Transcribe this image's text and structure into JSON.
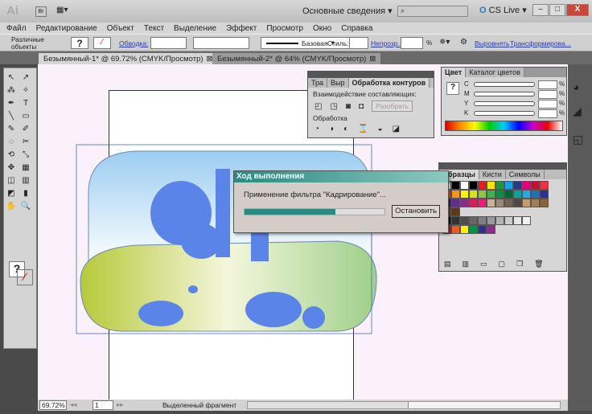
{
  "app": {
    "logo": "Ai",
    "bridge": "Br",
    "workspace": "Основные сведения",
    "search_placeholder": "",
    "cslive": "CS Live"
  },
  "menu": [
    "Файл",
    "Редактирование",
    "Объект",
    "Текст",
    "Выделение",
    "Эффект",
    "Просмотр",
    "Окно",
    "Справка"
  ],
  "control": {
    "selection": "Различные объекты",
    "fill": "?",
    "stroke_label": "Обводка:",
    "brush": "Базовая",
    "style_label": "Стиль:",
    "opacity_label": "Непрозр.:",
    "opacity_unit": "%",
    "align": "Выровнять",
    "transform": "Трансформирова..."
  },
  "tabs": [
    {
      "label": "Безымянный-1* @ 69.72% (CMYK/Просмотр)",
      "active": true
    },
    {
      "label": "Безымянный-2* @ 64% (CMYK/Просмотр)",
      "active": false
    }
  ],
  "pathfinder": {
    "tabs": [
      "Тра",
      "Выр",
      "Обработка контуров"
    ],
    "shape_modes": "Взаимодействие составляющих:",
    "expand": "Разобрать",
    "pathfinders": "Обработка"
  },
  "color": {
    "tabs": [
      "Цвет",
      "Каталог цветов"
    ],
    "channels": [
      "C",
      "M",
      "Y",
      "K"
    ],
    "unit": "%"
  },
  "swatches": {
    "tabs": [
      "Образцы",
      "Кисти",
      "Символы"
    ],
    "colors": [
      "#ffffff",
      "#000000",
      "#e31b23",
      "#ffe600",
      "#1a9a3a",
      "#1aa3e0",
      "#2b3590",
      "#e6007e",
      "#c8102e",
      "#ef3340",
      "#f15a24",
      "#f7941d",
      "#fff200",
      "#d7df23",
      "#8dc63f",
      "#39b54a",
      "#009444",
      "#006838",
      "#00a79d",
      "#27aae1",
      "#1c75bc",
      "#2e3192",
      "#262262",
      "#662d91",
      "#92278f",
      "#d91c5c",
      "#ed1e79",
      "#c7b299",
      "#998675",
      "#736357",
      "#534741",
      "#c69c6d",
      "#a67c52",
      "#8c6239",
      "#754c24",
      "#603813"
    ],
    "grays": [
      "#000000",
      "#333333",
      "#4d4d4d",
      "#666666",
      "#808080",
      "#999999",
      "#b3b3b3",
      "#cccccc",
      "#e6e6e6",
      "#f2f2f2"
    ],
    "group": [
      "#e31b23",
      "#f15a24",
      "#fff200",
      "#009444",
      "#2e3192",
      "#92278f"
    ]
  },
  "progress": {
    "title": "Ход выполнения",
    "message": "Применение фильтра \"Кадрирование\"...",
    "value": 65,
    "stop": "Остановить"
  },
  "status": {
    "zoom": "69.72%",
    "page": "1",
    "info": "Выделенный фрагмент"
  },
  "accent": "#2a8a80"
}
